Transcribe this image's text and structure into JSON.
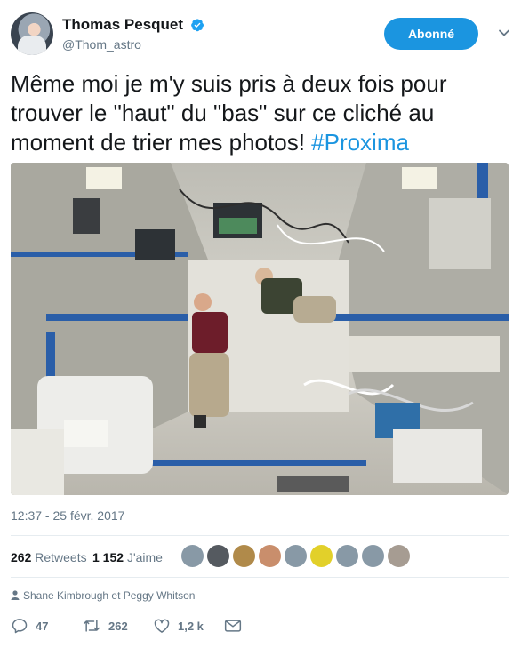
{
  "author": {
    "name": "Thomas Pesquet",
    "handle": "@Thom_astro"
  },
  "follow_button": {
    "label": "Abonné"
  },
  "tweet": {
    "text": "Même moi je m'y suis pris à deux fois pour trouver le \"haut\" du \"bas\" sur ce cliché au moment de trier mes photos!  ",
    "hashtag": "#Proxima",
    "timestamp": "12:37 - 25 févr. 2017"
  },
  "stats": {
    "retweets_count": "262",
    "retweets_label": "Retweets",
    "likes_count": "1 152",
    "likes_label": "J'aime"
  },
  "likers": [
    {
      "icon": "default-avatar",
      "color": "#8899a6"
    },
    {
      "icon": "moon-avatar",
      "color": "#555a60"
    },
    {
      "icon": "dog-avatar",
      "color": "#b08a4a"
    },
    {
      "icon": "person-avatar",
      "color": "#c98e6c"
    },
    {
      "icon": "default-avatar",
      "color": "#8899a6"
    },
    {
      "icon": "pattern-avatar",
      "color": "#e2d02a"
    },
    {
      "icon": "default-avatar",
      "color": "#8899a6"
    },
    {
      "icon": "default-avatar",
      "color": "#8899a6"
    },
    {
      "icon": "cat-avatar",
      "color": "#a69c92"
    }
  ],
  "context": {
    "text": "Shane Kimbrough et Peggy Whitson"
  },
  "actions": {
    "reply_count": "47",
    "retweet_count": "262",
    "like_count": "1,2 k"
  },
  "colors": {
    "accent": "#1b95e0",
    "muted": "#657786",
    "text": "#14171a"
  }
}
